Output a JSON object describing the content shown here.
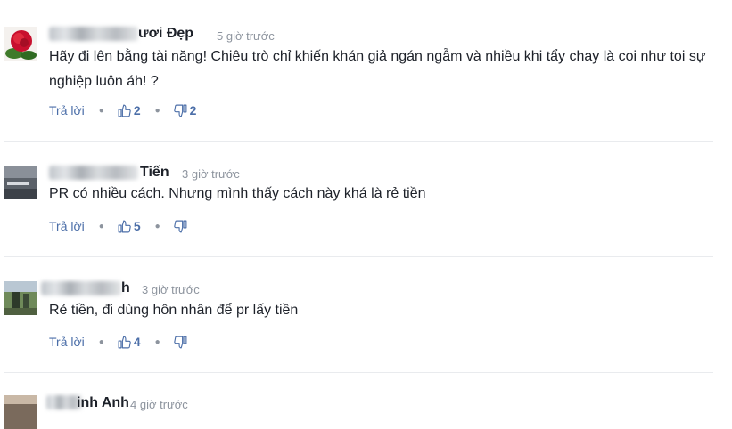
{
  "comments": [
    {
      "name": "ươi Đẹp",
      "time": "5 giờ trước",
      "text": "Hãy đi lên bằng tài năng! Chiêu trò chỉ khiến khán giả ngán ngẫm và nhiều khi tẩy chay là coi như toi sự nghiệp luôn áh! ?",
      "reply_label": "Trả lời",
      "likes": "2",
      "dislikes": "2"
    },
    {
      "name": "Tiến",
      "time": "3 giờ trước",
      "text": "PR có nhiều cách. Nhưng mình thấy cách này khá là rẻ tiền",
      "reply_label": "Trả lời",
      "likes": "5",
      "dislikes": ""
    },
    {
      "name": "h",
      "time": "3 giờ trước",
      "text": "Rẻ tiền, đi dùng hôn nhân để pr lấy tiền",
      "reply_label": "Trả lời",
      "likes": "4",
      "dislikes": ""
    },
    {
      "name": "inh Anh",
      "time": "4 giờ trước"
    }
  ],
  "icons": {
    "like": "thumbs-up-icon",
    "dislike": "thumbs-down-icon",
    "separator": "dot-separator"
  },
  "colors": {
    "link": "#4b6ea8",
    "meta": "#8d949e",
    "divider": "#e9ebee"
  }
}
